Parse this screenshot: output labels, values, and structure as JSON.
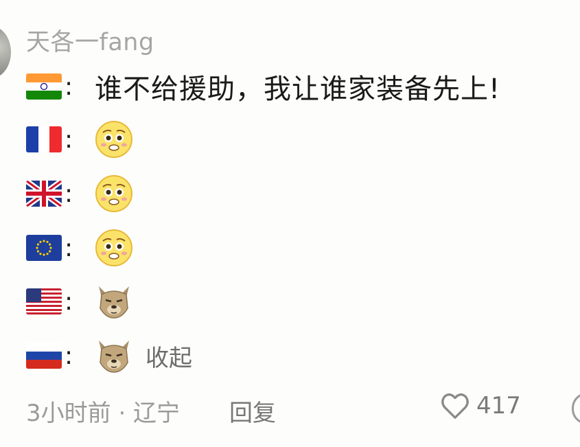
{
  "comment": {
    "username": "天各一fang",
    "lines": [
      {
        "flag_icon": "india-flag-icon",
        "text": "谁不给援助，我让谁家装备先上!"
      },
      {
        "flag_icon": "france-flag-icon",
        "emoji_icon": "pleading-face-icon"
      },
      {
        "flag_icon": "uk-flag-icon",
        "emoji_icon": "pleading-face-icon"
      },
      {
        "flag_icon": "eu-flag-icon",
        "emoji_icon": "pleading-face-icon"
      },
      {
        "flag_icon": "usa-flag-icon",
        "emoji_icon": "dog-face-icon"
      },
      {
        "flag_icon": "russia-flag-icon",
        "emoji_icon": "dog-face-icon"
      }
    ],
    "colon": ":",
    "collapse_label": "收起",
    "meta": "3小时前 · 辽宁",
    "reply_label": "回复",
    "like_count": "417"
  },
  "colors": {
    "background": "#fdfdfb",
    "muted_text": "#a5a5a5"
  }
}
